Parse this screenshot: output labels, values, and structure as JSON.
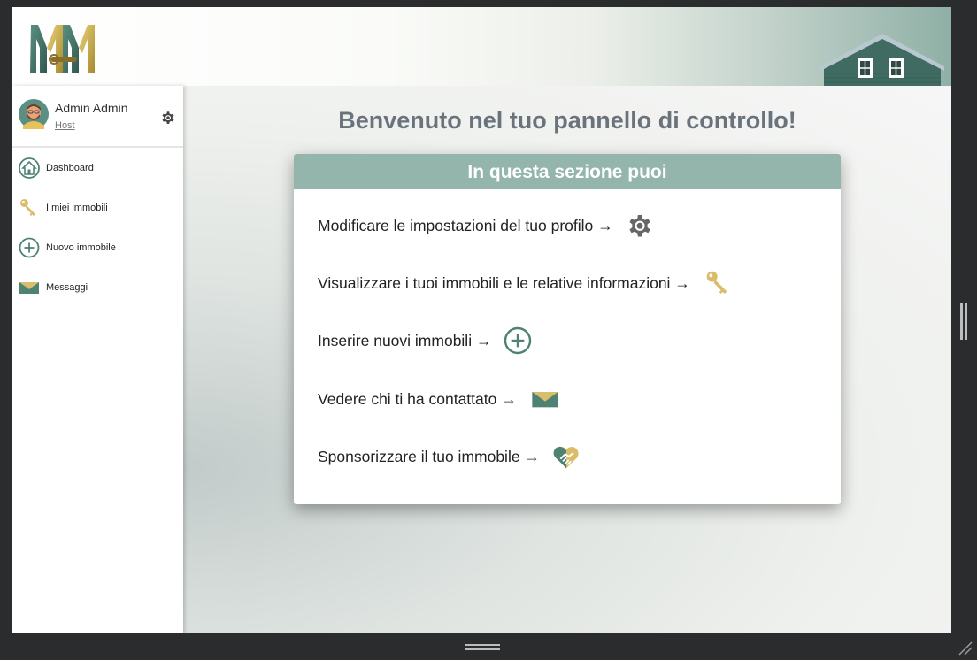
{
  "header": {
    "logo_icon": "mm-logo-icon",
    "house_icon": "house-icon"
  },
  "user": {
    "name": "Admin Admin",
    "role": "Host",
    "settings_icon": "gear-icon"
  },
  "sidebar": {
    "items": [
      {
        "label": "Dashboard",
        "icon": "home-icon"
      },
      {
        "label": "I miei immobili",
        "icon": "key-icon"
      },
      {
        "label": "Nuovo immobile",
        "icon": "plus-circle-icon"
      },
      {
        "label": "Messaggi",
        "icon": "envelope-icon"
      }
    ]
  },
  "main": {
    "welcome": "Benvenuto nel tuo pannello di controllo!",
    "card": {
      "title": "In questa sezione puoi",
      "items": [
        {
          "text": "Modificare le impostazioni del tuo profilo →",
          "icon": "gear-icon"
        },
        {
          "text": "Visualizzare i tuoi immobili e le relative informazioni →",
          "icon": "key-icon"
        },
        {
          "text": "Inserire nuovi immobili →",
          "icon": "plus-circle-icon"
        },
        {
          "text": "Vedere chi ti ha contattato →",
          "icon": "envelope-icon"
        },
        {
          "text": "Sponsorizzare il tuo immobile →",
          "icon": "handshake-heart-icon"
        }
      ]
    }
  },
  "colors": {
    "accent": "#93b5ab",
    "green": "#4e8275",
    "gold": "#d4b45c",
    "dark": "#2b2c2e"
  }
}
